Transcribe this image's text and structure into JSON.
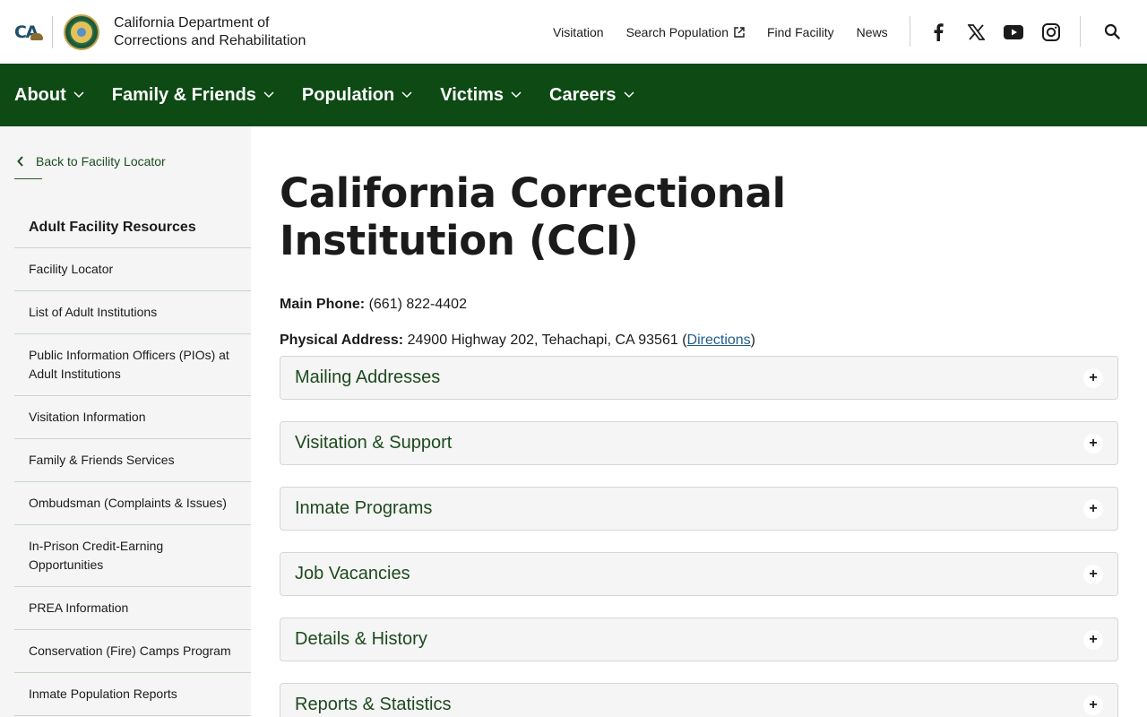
{
  "header": {
    "org_name": "California Department of Corrections and Rehabilitation",
    "ca_logo_text": "CA",
    "util_links": [
      {
        "label": "Visitation"
      },
      {
        "label": "Search Population",
        "external": true
      },
      {
        "label": "Find Facility"
      },
      {
        "label": "News"
      }
    ],
    "social": [
      "facebook-icon",
      "x-icon",
      "youtube-icon",
      "instagram-icon"
    ]
  },
  "main_nav": {
    "items": [
      {
        "label": "About"
      },
      {
        "label": "Family & Friends"
      },
      {
        "label": "Population"
      },
      {
        "label": "Victims"
      },
      {
        "label": "Careers"
      }
    ]
  },
  "sidebar": {
    "back_label": "Back to Facility Locator",
    "title": "Adult Facility Resources",
    "items": [
      {
        "label": "Facility Locator"
      },
      {
        "label": "List of Adult Institutions"
      },
      {
        "label": "Public Information Officers (PIOs) at Adult Institutions"
      },
      {
        "label": "Visitation Information"
      },
      {
        "label": "Family & Friends Services"
      },
      {
        "label": "Ombudsman (Complaints & Issues)"
      },
      {
        "label": "In-Prison Credit-Earning Opportunities"
      },
      {
        "label": "PREA Information"
      },
      {
        "label": "Conservation (Fire) Camps Program"
      },
      {
        "label": "Inmate Population Reports"
      }
    ]
  },
  "main": {
    "title": "California Correctional Institution (CCI)",
    "phone_label": "Main Phone:",
    "phone_value": "(661) 822-4402",
    "address_label": "Physical Address:",
    "address_value": "24900 Highway 202, Tehachapi, CA 93561",
    "directions_label": "Directions",
    "accordion": [
      {
        "title": "Mailing Addresses"
      },
      {
        "title": "Visitation & Support"
      },
      {
        "title": "Inmate Programs"
      },
      {
        "title": "Job Vacancies"
      },
      {
        "title": "Details & History"
      },
      {
        "title": "Reports & Statistics"
      }
    ],
    "plus_symbol": "+"
  },
  "colors": {
    "nav_green": "#0d4a14",
    "link_blue": "#1f5c8b",
    "accordion_title_green": "#1d4a1f"
  }
}
